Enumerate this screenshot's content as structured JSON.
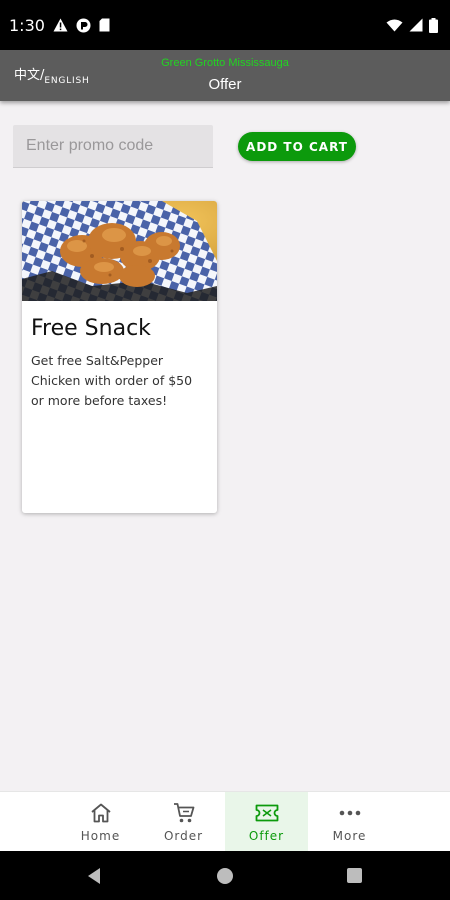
{
  "status_bar": {
    "time": "1:30",
    "icons": [
      "warning-icon",
      "pocket-icon",
      "sim-card-icon",
      "wifi-icon",
      "signal-icon",
      "battery-icon"
    ]
  },
  "app_bar": {
    "lang_zh": "中文",
    "lang_slash": "/",
    "lang_en": "ENGLISH",
    "store_name": "Green Grotto Mississauga",
    "title": "Offer",
    "store_color": "#22d422",
    "background": "#5c5c5c"
  },
  "promo": {
    "placeholder": "Enter promo code",
    "value": "",
    "button_label": "ADD TO CART",
    "button_color": "#0c9a0c"
  },
  "offers": [
    {
      "title": "Free Snack",
      "description": "Get free Salt&Pepper Chicken with order of $50 or more before taxes!",
      "image": "salt-pepper-chicken-photo"
    }
  ],
  "bottom_nav": {
    "items": [
      {
        "label": "Home",
        "icon": "home-icon",
        "active": false
      },
      {
        "label": "Order",
        "icon": "cart-icon",
        "active": false
      },
      {
        "label": "Offer",
        "icon": "ticket-icon",
        "active": true
      },
      {
        "label": "More",
        "icon": "more-horizontal-icon",
        "active": false
      }
    ],
    "active_color": "#0c9a0c"
  },
  "system_nav": {
    "icons": [
      "back-icon",
      "home-circle-icon",
      "recents-icon"
    ]
  }
}
